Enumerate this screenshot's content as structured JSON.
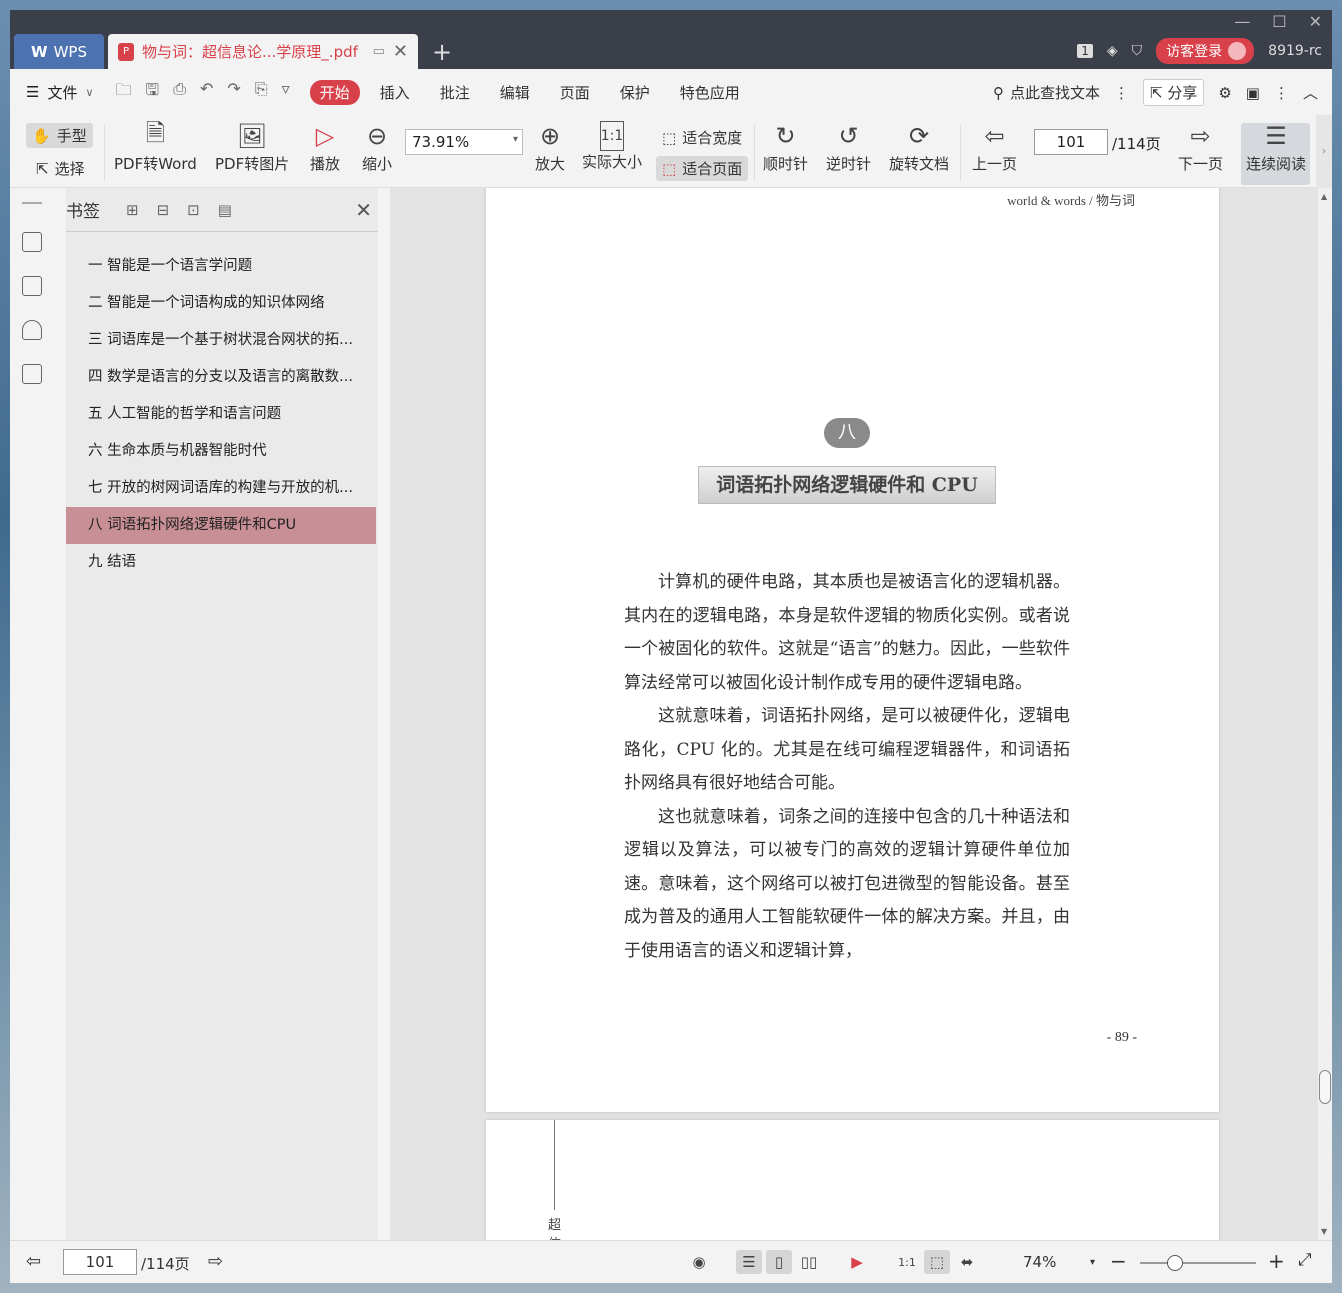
{
  "titlebar": {
    "wps_label": "WPS",
    "doc_tab_title": "物与词：超信息论...学原理_.pdf",
    "new_tab_glyph": "+",
    "page_count_badge": "1",
    "login_label": "访客登录",
    "user_id": "8919-rc"
  },
  "menubar": {
    "file_label": "文件",
    "tabs": [
      "开始",
      "插入",
      "批注",
      "编辑",
      "页面",
      "保护",
      "特色应用"
    ],
    "active_tab": "开始",
    "search_label": "点此查找文本",
    "share_label": "分享"
  },
  "toolbar": {
    "hand_label": "手型",
    "select_label": "选择",
    "pdf_to_word": "PDF转Word",
    "pdf_to_image": "PDF转图片",
    "play": "播放",
    "zoom_out": "缩小",
    "zoom_value": "73.91%",
    "zoom_in": "放大",
    "actual_size": "实际大小",
    "fit_width": "适合宽度",
    "fit_page": "适合页面",
    "clockwise": "顺时针",
    "counter_clockwise": "逆时针",
    "rotate_doc": "旋转文档",
    "prev_page": "上一页",
    "current_page": "101",
    "total_pages": "/114页",
    "next_page": "下一页",
    "continuous_read": "连续阅读"
  },
  "bookmarks": {
    "title": "书签",
    "items": [
      "一 智能是一个语言学问题",
      "二 智能是一个词语构成的知识体网络",
      "三 词语库是一个基于树状混合网状的拓...",
      "四 数学是语言的分支以及语言的离散数...",
      "五 人工智能的哲学和语言问题",
      "六 生命本质与机器智能时代",
      "七 开放的树网词语库的构建与开放的机...",
      "八 词语拓扑网络逻辑硬件和CPU",
      "九 结语"
    ],
    "selected_index": 7
  },
  "page": {
    "running_head": "world & words / 物与词",
    "chapter_number": "八",
    "chapter_title": "词语拓扑网络逻辑硬件和 CPU",
    "paragraphs": [
      "计算机的硬件电路，其本质也是被语言化的逻辑机器。其内在的逻辑电路，本身是软件逻辑的物质化实例。或者说一个被固化的软件。这就是“语言”的魅力。因此，一些软件算法经常可以被固化设计制作成专用的硬件逻辑电路。",
      "这就意味着，词语拓扑网络，是可以被硬件化，逻辑电路化，CPU 化的。尤其是在线可编程逻辑器件，和词语拓扑网络具有很好地结合可能。",
      "这也就意味着，词条之间的连接中包含的几十种语法和逻辑以及算法，可以被专门的高效的逻辑计算硬件单位加速。意味着，这个网络可以被打包进微型的智能设备。甚至成为普及的通用人工智能软硬件一体的解决方案。并且，由于使用语言的语义和逻辑计算，"
    ],
    "page_number": "- 89 -",
    "next_page_fragment": "超信"
  },
  "statusbar": {
    "current_page": "101",
    "total_pages": "/114页",
    "zoom_percent": "74%",
    "zoom_level": 0.3
  },
  "colors": {
    "accent": "#d8414a",
    "titlebar": "#3b3f4a",
    "wps_tab": "#4c72b0",
    "bookmark_selected": "#c98f97"
  }
}
